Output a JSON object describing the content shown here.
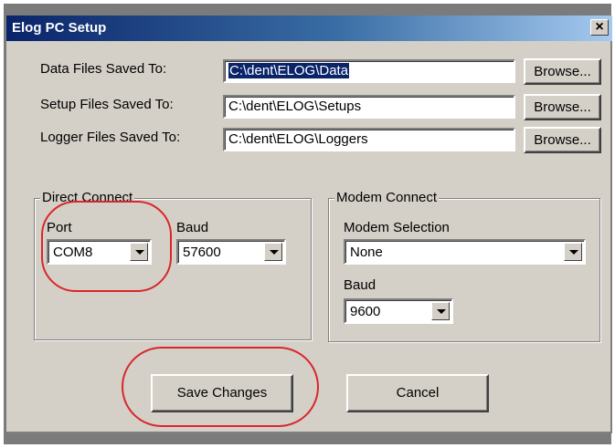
{
  "window": {
    "title": "Elog PC Setup",
    "close_glyph": "×"
  },
  "paths": [
    {
      "label": "Data Files Saved To:",
      "value": "C:\\dent\\ELOG\\Data",
      "button": "Browse..."
    },
    {
      "label": "Setup Files Saved To:",
      "value": "C:\\dent\\ELOG\\Setups",
      "button": "Browse..."
    },
    {
      "label": "Logger Files Saved To:",
      "value": "C:\\dent\\ELOG\\Loggers",
      "button": "Browse..."
    }
  ],
  "direct_connect": {
    "title": "Direct Connect",
    "port_label": "Port",
    "port_value": "COM8",
    "baud_label": "Baud",
    "baud_value": "57600"
  },
  "modem_connect": {
    "title": "Modem Connect",
    "selection_label": "Modem Selection",
    "selection_value": "None",
    "baud_label": "Baud",
    "baud_value": "9600"
  },
  "actions": {
    "save": "Save Changes",
    "cancel": "Cancel"
  },
  "colors": {
    "highlight": "#d9262b",
    "titlebar": "#0a246a",
    "dialog": "#d4d0c8"
  }
}
